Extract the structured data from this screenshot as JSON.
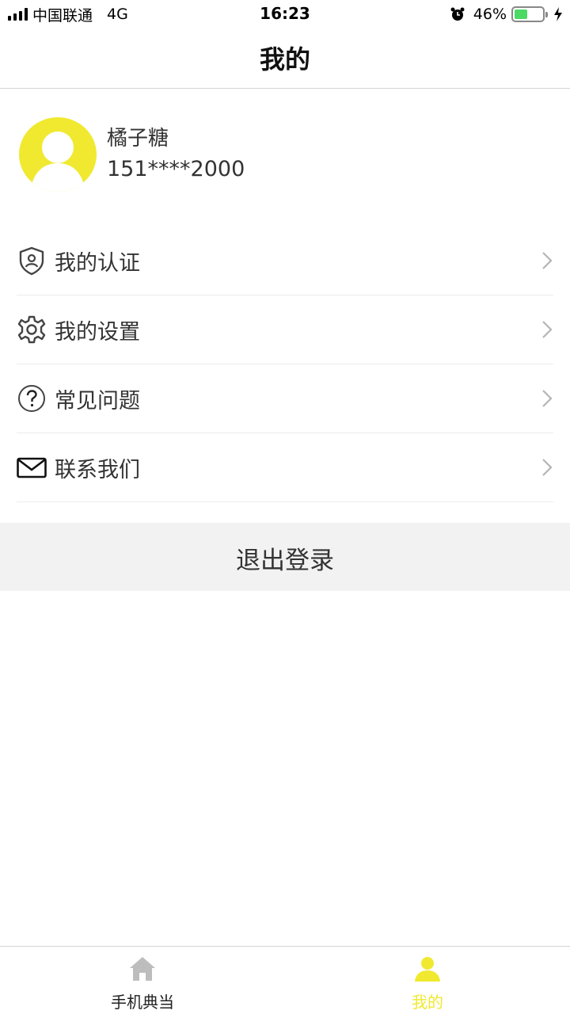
{
  "status_bar": {
    "carrier": "中国联通",
    "network": "4G",
    "time": "16:23",
    "battery_percent": "46%",
    "battery_level": 0.46,
    "icons": [
      "signal-icon",
      "alarm-icon",
      "battery-icon",
      "charging-icon"
    ]
  },
  "nav": {
    "title": "我的"
  },
  "profile": {
    "name": "橘子糖",
    "phone": "151****2000",
    "avatar_color": "#f0e930"
  },
  "menu": {
    "items": [
      {
        "label": "我的认证",
        "icon": "shield-user-icon"
      },
      {
        "label": "我的设置",
        "icon": "gear-icon"
      },
      {
        "label": "常见问题",
        "icon": "question-icon"
      },
      {
        "label": "联系我们",
        "icon": "mail-icon"
      }
    ]
  },
  "logout": {
    "label": "退出登录"
  },
  "tab_bar": {
    "tabs": [
      {
        "label": "手机典当",
        "icon": "home-icon",
        "active": false
      },
      {
        "label": "我的",
        "icon": "person-icon",
        "active": true
      }
    ],
    "active_color": "#f0e930",
    "inactive_color": "#bdbdbd"
  }
}
